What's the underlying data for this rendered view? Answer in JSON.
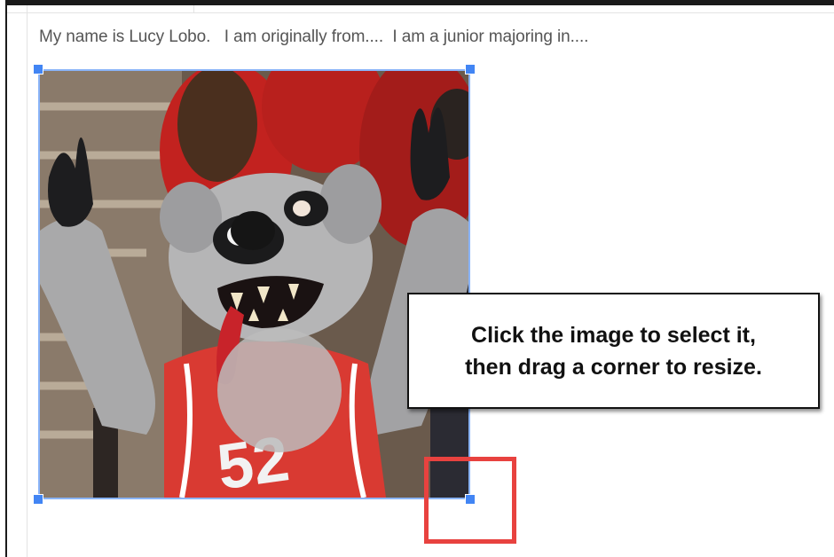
{
  "document": {
    "body_text": "My name is Lucy Lobo.   I am originally from....  I am a junior majoring in...."
  },
  "image": {
    "alt": "Lobo mascot with arms raised",
    "jersey_number": "52",
    "selected": true,
    "selection_color": "#4285f4"
  },
  "callout": {
    "line1": "Click the image to select it,",
    "line2": "then drag a corner to resize."
  },
  "highlight": {
    "color": "#e8423f"
  }
}
